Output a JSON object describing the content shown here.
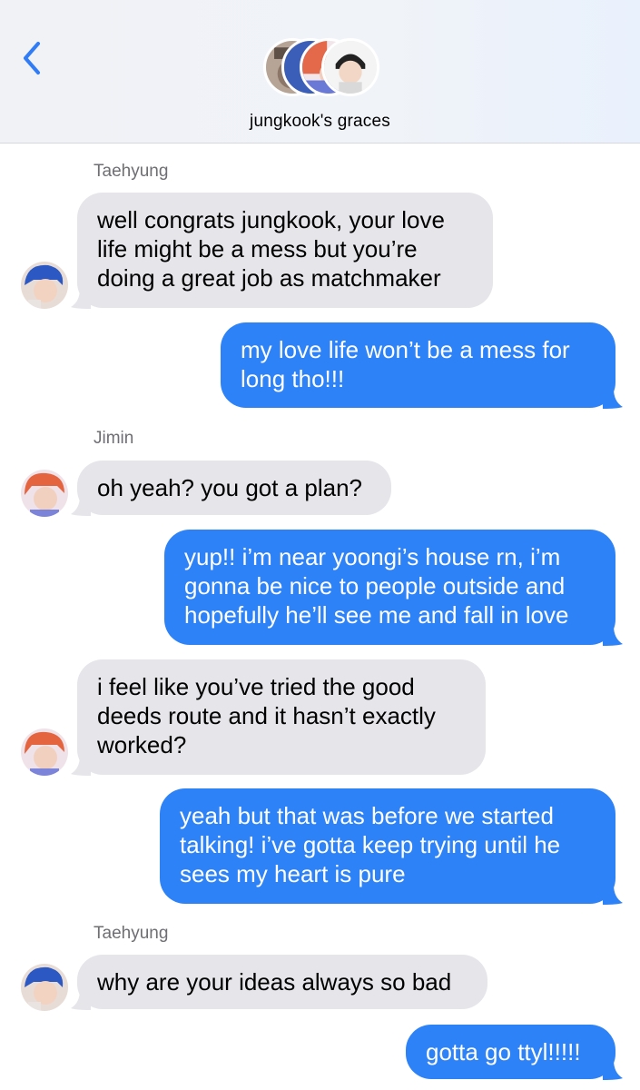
{
  "header": {
    "group_title": "jungkook's graces",
    "back_icon": "chevron-left-icon",
    "accent": "#2f7cf6"
  },
  "messages": [
    {
      "sender": "Taehyung"
    },
    {
      "lines": [
        "well congrats jungkook, your love",
        "life might be a mess but you’re",
        "doing a great job as matchmaker"
      ]
    },
    {
      "lines": [
        "my love life won’t be a mess for",
        "long tho!!!"
      ]
    },
    {
      "sender": "Jimin"
    },
    {
      "lines": [
        "oh yeah? you got a plan?"
      ]
    },
    {
      "lines": [
        "yup!! i’m near yoongi’s house rn, i’m",
        "gonna be nice to people outside and",
        "hopefully he’ll see me and fall in love"
      ]
    },
    {
      "lines": [
        "i feel like you’ve tried the good",
        "deeds route and it hasn’t exactly",
        "worked?"
      ]
    },
    {
      "lines": [
        "yeah but that was before we started",
        "talking! i’ve gotta keep trying until he",
        "sees my heart is pure"
      ]
    },
    {
      "sender": "Taehyung"
    },
    {
      "lines": [
        "why are your ideas always so bad"
      ]
    },
    {
      "lines": [
        "gotta go ttyl!!!!!"
      ]
    }
  ],
  "colors": {
    "incoming_bubble": "#e5e5ea",
    "outgoing_bubble": "#2d82f7",
    "sender_label": "#6e6e73"
  }
}
